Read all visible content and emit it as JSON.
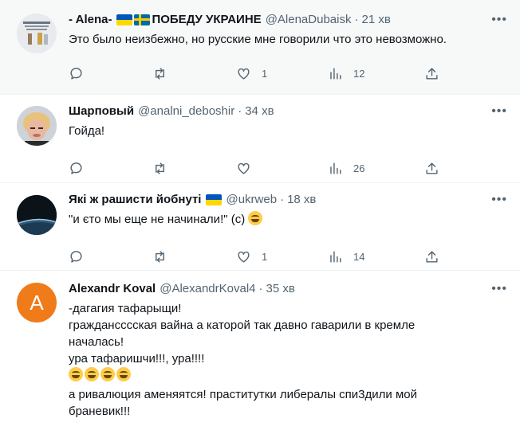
{
  "tweets": [
    {
      "name": "- Alena-",
      "name_suffix": "ПОБЕДУ УКРАИНЕ",
      "handle": "@AlenaDubaisk",
      "time": "21 хв",
      "text": "Это было неизбежно, но русские мне говорили что это невозможно.",
      "likes": "1",
      "views": "12"
    },
    {
      "name": "Шарповый",
      "handle": "@analni_deboshir",
      "time": "34 хв",
      "text": "Гойда!",
      "views": "26"
    },
    {
      "name": "Які ж рашисти йобнуті",
      "handle": "@ukrweb",
      "time": "18 хв",
      "text": "\"и єто мы еще не начинали!\" (с)",
      "likes": "1",
      "views": "14"
    },
    {
      "name": "Alexandr Koval",
      "handle": "@AlexandrKoval4",
      "time": "35 хв",
      "avatar_letter": "A",
      "text1": "-дагагия тафарыщи!\nграждансссская вайна а каторой так давно гаварили в кремле\nначалась!\nура тафаришчи!!!, ура!!!!",
      "text2": "а ривалюция аменяятся! праститутки либералы спи3дили мой\nбраневик!!!"
    }
  ],
  "separator": "·",
  "colors": {
    "text": "#0f1419",
    "secondary": "#536471",
    "divider": "#eff3f4",
    "highlight_bg": "#f7f9f9",
    "avatar_orange": "#ef7b1a"
  },
  "icons": [
    "reply-icon",
    "retweet-icon",
    "like-icon",
    "views-icon",
    "share-icon",
    "more-icon",
    "grinning-emoji-icon",
    "ukraine-flag-icon",
    "sweden-flag-icon"
  ]
}
